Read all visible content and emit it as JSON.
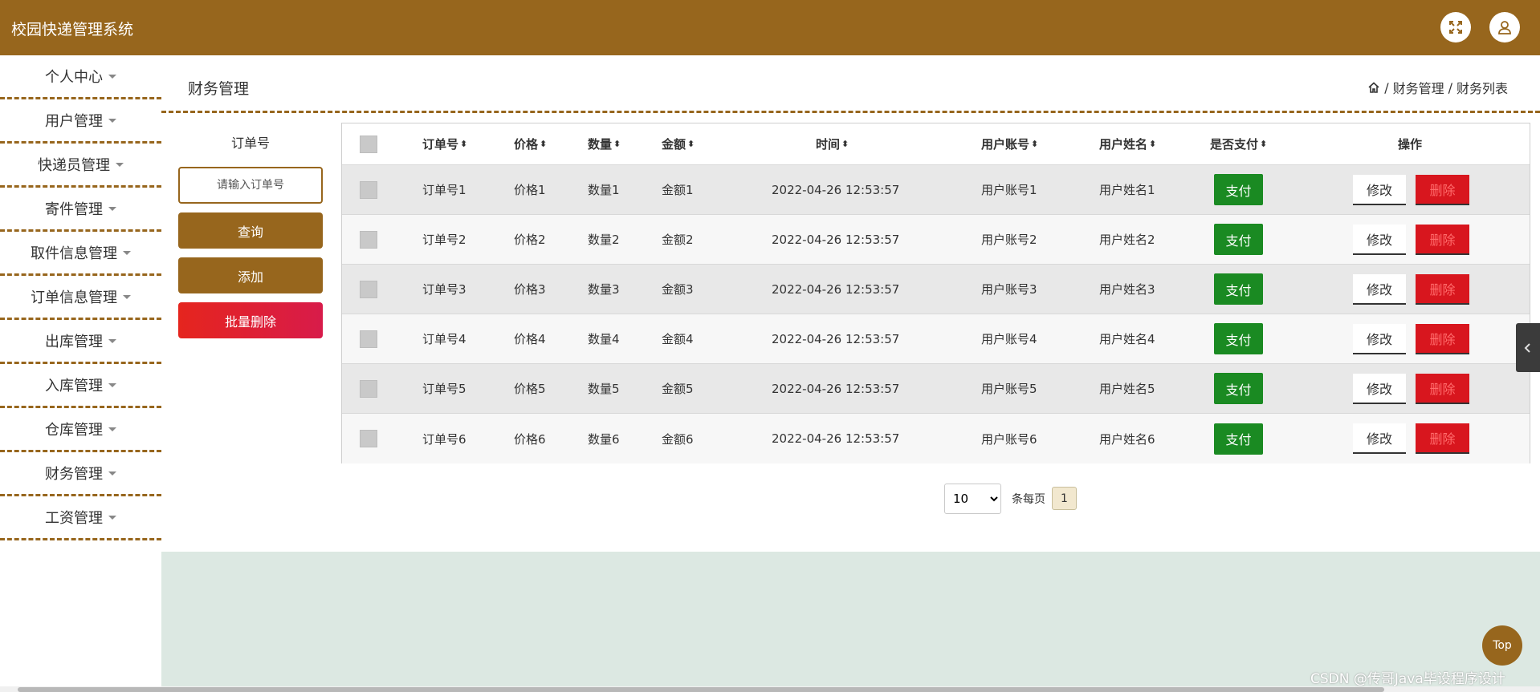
{
  "app": {
    "title": "校园快递管理系统"
  },
  "header": {
    "fullscreen_icon": "fullscreen-icon",
    "user_icon": "user-icon"
  },
  "sidebar": {
    "items": [
      {
        "label": "个人中心"
      },
      {
        "label": "用户管理"
      },
      {
        "label": "快递员管理"
      },
      {
        "label": "寄件管理"
      },
      {
        "label": "取件信息管理"
      },
      {
        "label": "订单信息管理"
      },
      {
        "label": "出库管理"
      },
      {
        "label": "入库管理"
      },
      {
        "label": "仓库管理"
      },
      {
        "label": "财务管理"
      },
      {
        "label": "工资管理"
      }
    ]
  },
  "page": {
    "title": "财务管理",
    "breadcrumb": [
      "财务管理",
      "财务列表"
    ]
  },
  "search": {
    "label": "订单号",
    "placeholder": "请输入订单号",
    "query_label": "查询",
    "add_label": "添加",
    "batch_delete_label": "批量删除"
  },
  "table": {
    "headers": {
      "order_no": "订单号",
      "price": "价格",
      "quantity": "数量",
      "amount": "金额",
      "time": "时间",
      "account": "用户账号",
      "name": "用户姓名",
      "paid": "是否支付",
      "actions": "操作"
    },
    "rows": [
      {
        "order_no": "订单号1",
        "price": "价格1",
        "quantity": "数量1",
        "amount": "金额1",
        "time": "2022-04-26 12:53:57",
        "account": "用户账号1",
        "name": "用户姓名1"
      },
      {
        "order_no": "订单号2",
        "price": "价格2",
        "quantity": "数量2",
        "amount": "金额2",
        "time": "2022-04-26 12:53:57",
        "account": "用户账号2",
        "name": "用户姓名2"
      },
      {
        "order_no": "订单号3",
        "price": "价格3",
        "quantity": "数量3",
        "amount": "金额3",
        "time": "2022-04-26 12:53:57",
        "account": "用户账号3",
        "name": "用户姓名3"
      },
      {
        "order_no": "订单号4",
        "price": "价格4",
        "quantity": "数量4",
        "amount": "金额4",
        "time": "2022-04-26 12:53:57",
        "account": "用户账号4",
        "name": "用户姓名4"
      },
      {
        "order_no": "订单号5",
        "price": "价格5",
        "quantity": "数量5",
        "amount": "金额5",
        "time": "2022-04-26 12:53:57",
        "account": "用户账号5",
        "name": "用户姓名5"
      },
      {
        "order_no": "订单号6",
        "price": "价格6",
        "quantity": "数量6",
        "amount": "金额6",
        "time": "2022-04-26 12:53:57",
        "account": "用户账号6",
        "name": "用户姓名6"
      }
    ],
    "pay_label": "支付",
    "edit_label": "修改",
    "delete_label": "删除"
  },
  "pagination": {
    "page_size": "10",
    "page_size_options": [
      "10"
    ],
    "per_page_label": "条每页",
    "current_page": "1"
  },
  "top_button": "Top",
  "watermark": "CSDN @传哥Java毕设程序设计",
  "colors": {
    "primary": "#97661d",
    "danger": "#d8161e",
    "success": "#1a8a22",
    "panel": "#dce8e2"
  }
}
